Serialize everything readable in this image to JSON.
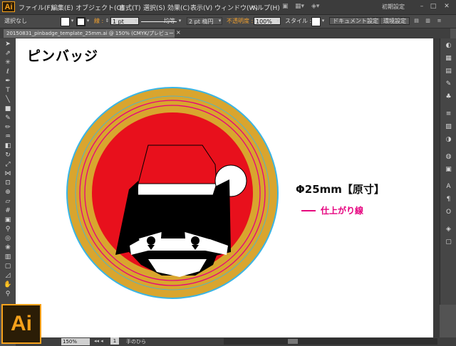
{
  "app": {
    "logo_small": "Ai",
    "logo_big": "Ai",
    "workspace": "初期設定"
  },
  "menu": [
    "ファイル(F)",
    "編集(E)",
    "オブジェクト(O)",
    "書式(T)",
    "選択(S)",
    "効果(C)",
    "表示(V)",
    "ウィンドウ(W)",
    "ヘルプ(H)"
  ],
  "control": {
    "selection": "選択なし",
    "stroke_label": "線 :",
    "stroke_weight": "1 pt",
    "profile": "均等",
    "brush": "2 pt 楕円",
    "opacity_label": "不透明度 :",
    "opacity": "100%",
    "style_label": "スタイル :",
    "doc_setup": "ドキュメント設定",
    "prefs": "環境設定"
  },
  "document": {
    "tab": "20150831_pinbadge_template_25mm.ai @ 150% (CMYK/プレビュー)",
    "close": "×"
  },
  "artboard": {
    "title": "ピンバッジ",
    "dimension": "Φ25mm【原寸】",
    "trim_label": "仕上がり線"
  },
  "status": {
    "zoom": "150%",
    "page": "1",
    "tool": "手のひら"
  },
  "icons": [
    "selection-tool-icon",
    "direct-selection-icon",
    "magic-wand-icon",
    "lasso-icon",
    "pen-icon",
    "type-icon",
    "line-icon",
    "rectangle-icon",
    "paintbrush-icon",
    "pencil-icon",
    "blob-brush-icon",
    "eraser-icon",
    "rotate-icon",
    "scale-icon",
    "width-icon",
    "free-transform-icon",
    "shape-builder-icon",
    "perspective-icon",
    "mesh-icon",
    "gradient-icon",
    "eyedropper-icon",
    "blend-icon",
    "symbol-sprayer-icon",
    "graph-icon",
    "artboard-icon",
    "slice-icon",
    "hand-icon",
    "zoom-icon"
  ],
  "colors": {
    "red": "#e8101c",
    "gold": "#d9a52e",
    "magenta": "#e6007e",
    "cyan": "#39b5e6"
  }
}
